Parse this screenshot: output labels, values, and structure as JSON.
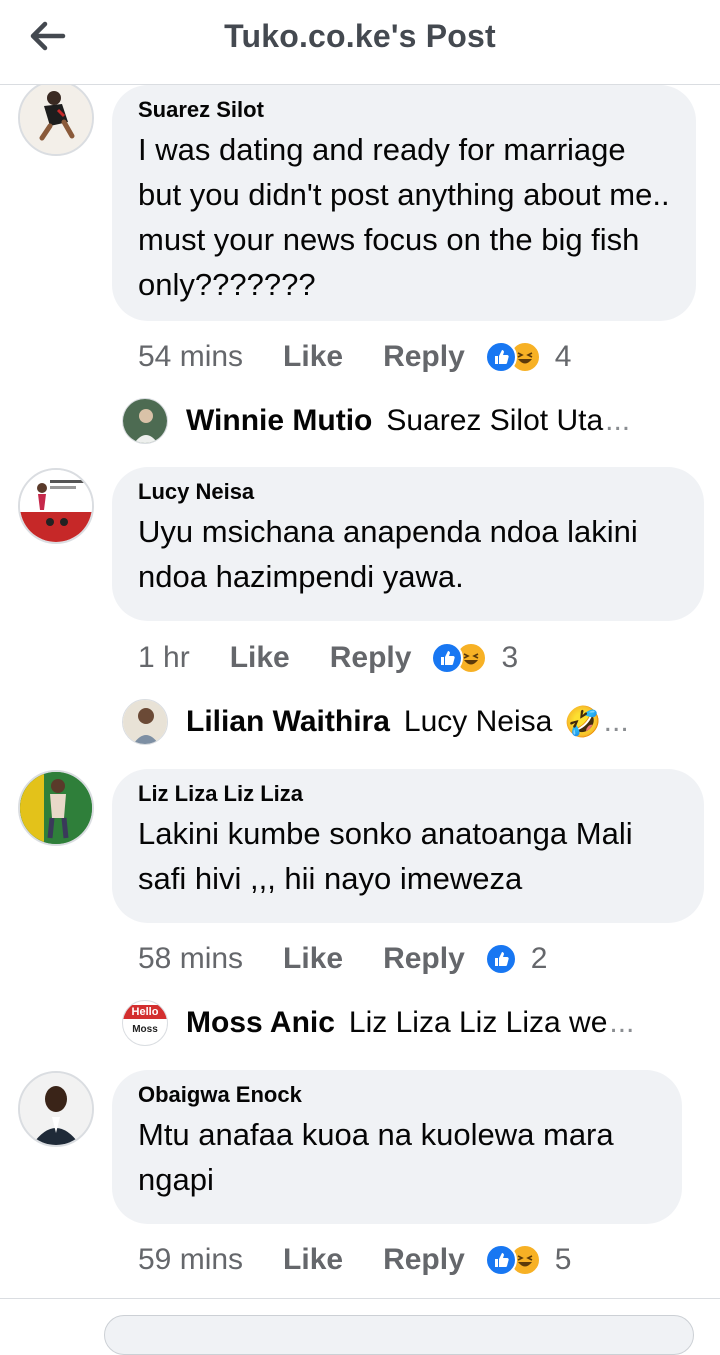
{
  "header": {
    "title": "Tuko.co.ke's Post"
  },
  "comments": [
    {
      "author": "Suarez Silot",
      "text": "I was dating and ready for marriage but you didn't post anything about me.. must your news focus on the big fish only???????",
      "time": "54 mins",
      "like_label": "Like",
      "reply_label": "Reply",
      "reactions": [
        "like",
        "haha"
      ],
      "reaction_count": "4",
      "reply": {
        "author": "Winnie Mutio",
        "snippet": "Suarez Silot Uta",
        "ellipsis": "..."
      }
    },
    {
      "author": "Lucy Neisa",
      "text": "Uyu msichana anapenda ndoa lakini ndoa hazimpendi yawa.",
      "time": "1 hr",
      "like_label": "Like",
      "reply_label": "Reply",
      "reactions": [
        "like",
        "haha"
      ],
      "reaction_count": "3",
      "avatar_text": "apologise like woman",
      "reply": {
        "author": "Lilian Waithira",
        "snippet": "Lucy Neisa",
        "emoji": "🤣",
        "ellipsis": "..."
      }
    },
    {
      "author": "Liz Liza Liz Liza",
      "text": "Lakini kumbe sonko anatoanga Mali safi hivi ,,, hii nayo imeweza",
      "time": "58 mins",
      "like_label": "Like",
      "reply_label": "Reply",
      "reactions": [
        "like"
      ],
      "reaction_count": "2",
      "reply": {
        "author": "Moss Anic",
        "snippet": "Liz Liza Liz Liza we",
        "ellipsis": "...",
        "avatar_text_top": "Hello",
        "avatar_text_bottom": "Moss"
      }
    },
    {
      "author": "Obaigwa Enock",
      "text": "Mtu anafaa kuoa na kuolewa mara ngapi",
      "time": "59 mins",
      "like_label": "Like",
      "reply_label": "Reply",
      "reactions": [
        "like",
        "haha"
      ],
      "reaction_count": "5"
    }
  ],
  "colors": {
    "bubble": "#f0f2f5",
    "meta": "#65676b",
    "like_blue": "#1877f2",
    "haha_yellow": "#f7b125"
  }
}
